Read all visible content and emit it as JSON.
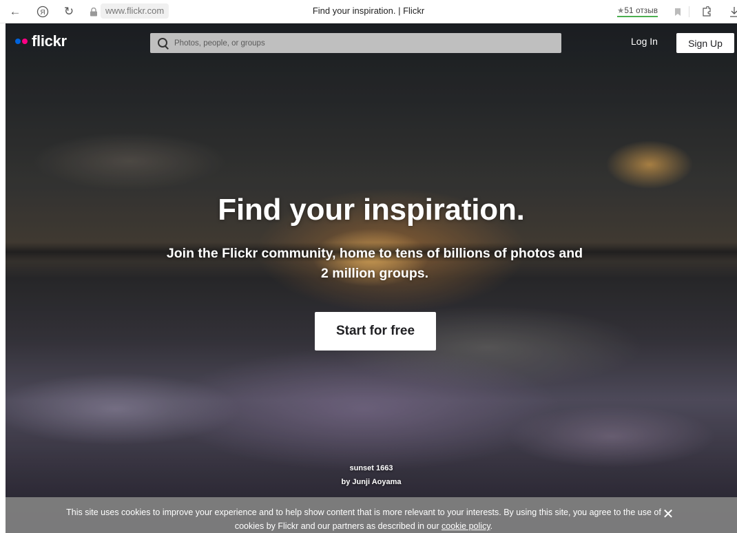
{
  "browser": {
    "url": "www.flickr.com",
    "tab_title": "Find your inspiration. | Flickr",
    "reviews": "51 отзыв",
    "icons": {
      "back": "back-arrow-icon",
      "yandex": "yandex-icon",
      "reload": "reload-icon",
      "lock": "lock-icon",
      "star": "star-icon",
      "bookmark": "bookmark-icon",
      "extensions": "extensions-icon",
      "download": "download-icon"
    }
  },
  "nav": {
    "logo_text": "flickr",
    "logo_colors": {
      "blue": "#0063dc",
      "pink": "#ff0084"
    },
    "search_placeholder": "Photos, people, or groups",
    "login_label": "Log In",
    "signup_label": "Sign Up"
  },
  "hero": {
    "headline": "Find your inspiration.",
    "subhead": "Join the Flickr community, home to tens of billions of photos and 2 million groups.",
    "cta_label": "Start for free",
    "photo_title": "sunset 1663",
    "photo_author": "by Junji Aoyama"
  },
  "cookie": {
    "text": "This site uses cookies to improve your experience and to help show content that is more relevant to your interests. By using this site, you agree to the use of cookies by Flickr and our partners as described in our ",
    "link_text": "cookie policy",
    "tail": ".",
    "close_icon": "close-icon"
  }
}
